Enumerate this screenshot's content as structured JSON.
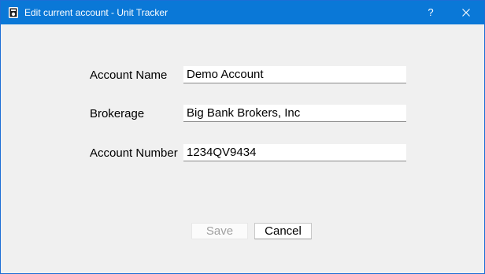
{
  "window": {
    "title": "Edit current account - Unit Tracker",
    "help_label": "?",
    "accent_color": "#0a78d7"
  },
  "icons": {
    "app": "app-icon",
    "close": "close-icon"
  },
  "form": {
    "account_name": {
      "label": "Account Name",
      "value": "Demo Account"
    },
    "brokerage": {
      "label": "Brokerage",
      "value": "Big Bank Brokers, Inc"
    },
    "account_number": {
      "label": "Account Number",
      "value": "1234QV9434"
    }
  },
  "buttons": {
    "save_label": "Save",
    "save_enabled": false,
    "cancel_label": "Cancel"
  }
}
